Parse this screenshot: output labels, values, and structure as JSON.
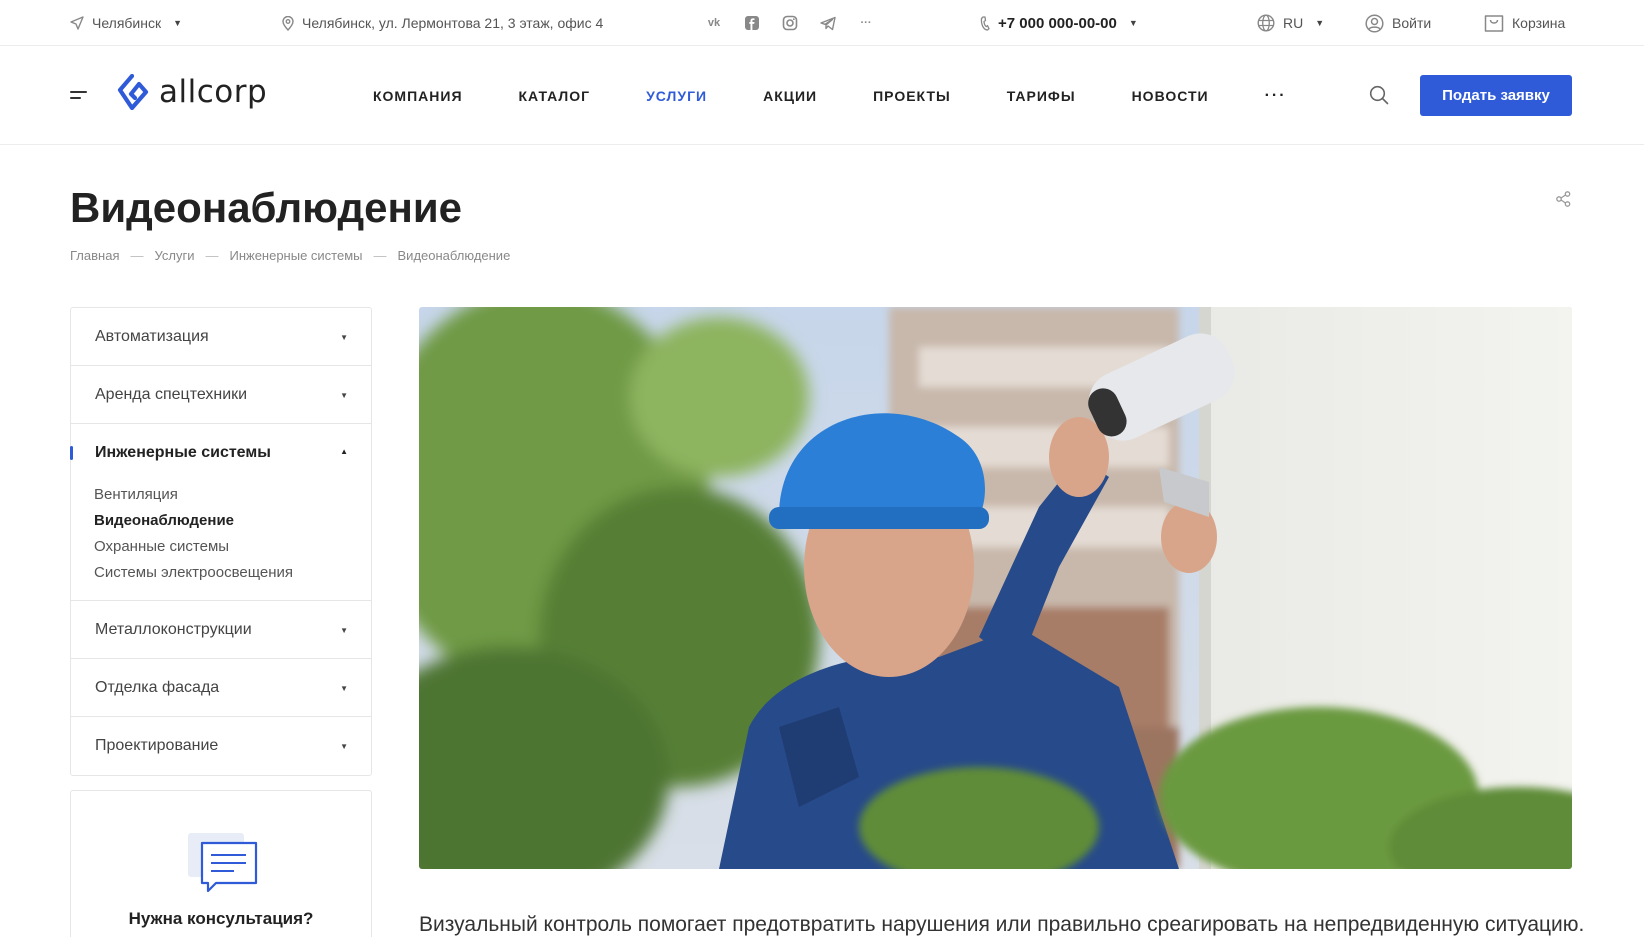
{
  "topbar": {
    "city": "Челябинск",
    "address": "Челябинск, ул. Лермонтова 21, 3 этаж, офис 4",
    "social": [
      "vk-icon",
      "facebook-icon",
      "instagram-icon",
      "telegram-icon"
    ],
    "social_more": "···",
    "phone": "+7 000 000-00-00",
    "language": "RU",
    "login": "Войти",
    "cart": "Корзина"
  },
  "header": {
    "logo_text": "allcorp",
    "nav": [
      "КОМПАНИЯ",
      "КАТАЛОГ",
      "УСЛУГИ",
      "АКЦИИ",
      "ПРОЕКТЫ",
      "ТАРИФЫ",
      "НОВОСТИ"
    ],
    "nav_active": "УСЛУГИ",
    "nav_more": "···",
    "cta": "Подать заявку"
  },
  "page": {
    "title": "Видеонаблюдение",
    "breadcrumb": [
      "Главная",
      "Услуги",
      "Инженерные системы",
      "Видеонаблюдение"
    ]
  },
  "sidebar": {
    "items": [
      {
        "label": "Автоматизация"
      },
      {
        "label": "Аренда спецтехники"
      },
      {
        "label": "Инженерные системы",
        "open": true,
        "children": [
          "Вентиляция",
          "Видеонаблюдение",
          "Охранные системы",
          "Системы электроосвещения"
        ],
        "current_child": "Видеонаблюдение"
      },
      {
        "label": "Металлоконструкции"
      },
      {
        "label": "Отделка фасада"
      },
      {
        "label": "Проектирование"
      }
    ],
    "consult_title": "Нужна консультация?"
  },
  "content": {
    "intro": "Визуальный контроль помогает предотвратить нарушения или правильно среагировать на непредвиденную ситуацию."
  },
  "colors": {
    "accent": "#2f5bd8",
    "text": "#222222",
    "border": "#e6e6e6"
  }
}
